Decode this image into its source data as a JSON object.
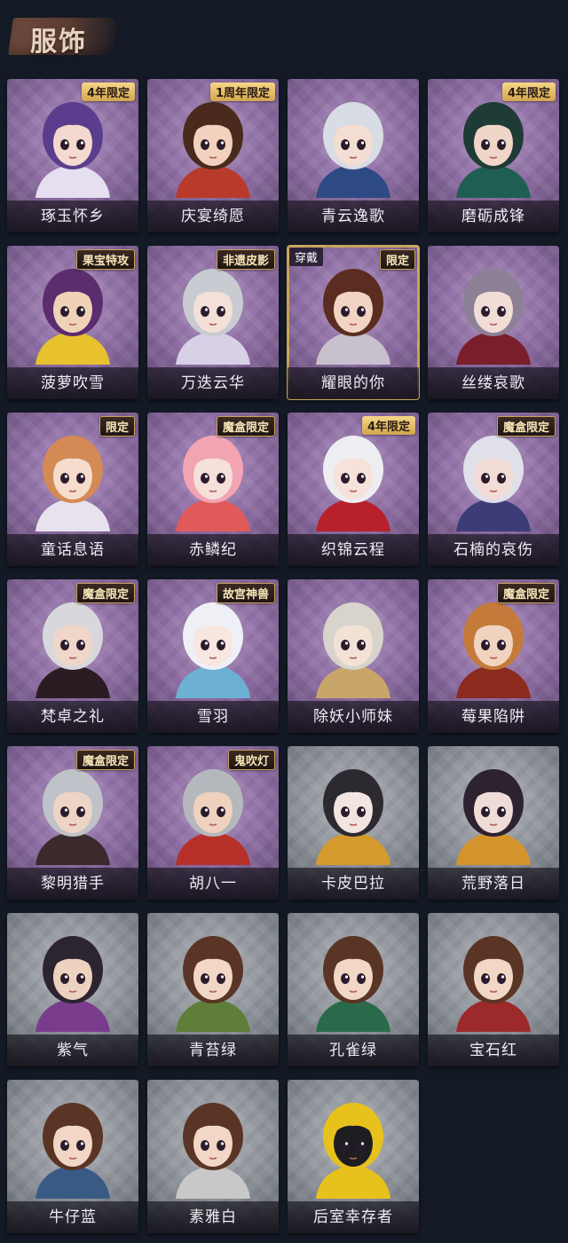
{
  "header": {
    "title": "服饰"
  },
  "items": [
    {
      "label": "琢玉怀乡",
      "tag": "4年限定",
      "theme": "purple",
      "hair": "#5a3d8c",
      "skin": "#f3d9cf",
      "outfit": "#e6dff0"
    },
    {
      "label": "庆宴绮愿",
      "tag": "1周年限定",
      "theme": "purple",
      "hair": "#4a2a1c",
      "skin": "#f2d2bf",
      "outfit": "#b93a2a"
    },
    {
      "label": "青云逸歌",
      "tag": "",
      "theme": "purple",
      "hair": "#d8dce4",
      "skin": "#f4ddd2",
      "outfit": "#2d4a84"
    },
    {
      "label": "磨砺成锋",
      "tag": "4年限定",
      "theme": "purple",
      "hair": "#1f3b36",
      "skin": "#f0d6c8",
      "outfit": "#1f5f52"
    },
    {
      "label": "菠萝吹雪",
      "tag": "果宝特攻",
      "theme": "purple",
      "hair": "#5b2c6e",
      "skin": "#f0d2b8",
      "outfit": "#e8c22e"
    },
    {
      "label": "万迭云华",
      "tag": "非遗皮影",
      "theme": "purple",
      "hair": "#c8ccd2",
      "skin": "#f4e0d8",
      "outfit": "#d7d0e6"
    },
    {
      "label": "耀眼的你",
      "tag": "限定",
      "worn": "穿戴",
      "theme": "purple",
      "hair": "#5b2c20",
      "skin": "#f2d4c4",
      "outfit": "#c8c0cc",
      "selected": true
    },
    {
      "label": "丝缕哀歌",
      "tag": "",
      "theme": "purple",
      "hair": "#8c8196",
      "skin": "#f2dcd6",
      "outfit": "#7a1e2c"
    },
    {
      "label": "童话息语",
      "tag": "限定",
      "theme": "purple",
      "hair": "#d48a54",
      "skin": "#f6dccc",
      "outfit": "#e8e2ee"
    },
    {
      "label": "赤鳞纪",
      "tag": "魔盒限定",
      "theme": "purple",
      "hair": "#f2a4b2",
      "skin": "#f6e0da",
      "outfit": "#e05a5a"
    },
    {
      "label": "织锦云程",
      "tag": "4年限定",
      "theme": "purple",
      "hair": "#eeeef2",
      "skin": "#f6e2da",
      "outfit": "#b8202c"
    },
    {
      "label": "石楠的哀伤",
      "tag": "魔盒限定",
      "theme": "purple",
      "hair": "#dfe0ea",
      "skin": "#f2dcd8",
      "outfit": "#3c3c78"
    },
    {
      "label": "梵卓之礼",
      "tag": "魔盒限定",
      "theme": "purple",
      "hair": "#d8d8dc",
      "skin": "#f0d6c8",
      "outfit": "#2a1c22"
    },
    {
      "label": "雪羽",
      "tag": "故宫神兽",
      "theme": "purple",
      "hair": "#eef0f6",
      "skin": "#f8e6e0",
      "outfit": "#6cb0d4"
    },
    {
      "label": "除妖小师妹",
      "tag": "",
      "theme": "purple",
      "hair": "#d8d4cc",
      "skin": "#f2e2d6",
      "outfit": "#c8a66a"
    },
    {
      "label": "莓果陷阱",
      "tag": "魔盒限定",
      "theme": "purple",
      "hair": "#c47a3a",
      "skin": "#f0d4c0",
      "outfit": "#8c2a1e"
    },
    {
      "label": "黎明猎手",
      "tag": "魔盒限定",
      "theme": "purple",
      "hair": "#bfc2c8",
      "skin": "#eed4c4",
      "outfit": "#3a2a2c"
    },
    {
      "label": "胡八一",
      "tag": "鬼吹灯",
      "theme": "purple",
      "hair": "#b4b8bc",
      "skin": "#eed2be",
      "outfit": "#b8302a"
    },
    {
      "label": "卡皮巴拉",
      "tag": "",
      "theme": "gray",
      "hair": "#2c2a30",
      "skin": "#f2e4e0",
      "outfit": "#d49a2e"
    },
    {
      "label": "荒野落日",
      "tag": "",
      "theme": "gray",
      "hair": "#2c2230",
      "skin": "#f0dcd6",
      "outfit": "#d4942c"
    },
    {
      "label": "紫气",
      "tag": "",
      "theme": "gray",
      "hair": "#2c2430",
      "skin": "#eed2c0",
      "outfit": "#7a3c8c"
    },
    {
      "label": "青苔绿",
      "tag": "",
      "theme": "gray",
      "hair": "#5a3424",
      "skin": "#f2d6c6",
      "outfit": "#5e7e3a"
    },
    {
      "label": "孔雀绿",
      "tag": "",
      "theme": "gray",
      "hair": "#5a3424",
      "skin": "#f2d6c6",
      "outfit": "#2a6a4a"
    },
    {
      "label": "宝石红",
      "tag": "",
      "theme": "gray",
      "hair": "#5a3424",
      "skin": "#f2d6c6",
      "outfit": "#9c2a2a"
    },
    {
      "label": "牛仔蓝",
      "tag": "",
      "theme": "gray",
      "hair": "#5a3424",
      "skin": "#f2d6c6",
      "outfit": "#3a5a86"
    },
    {
      "label": "素雅白",
      "tag": "",
      "theme": "gray",
      "hair": "#5a3424",
      "skin": "#f2d6c6",
      "outfit": "#c8c8c8"
    },
    {
      "label": "后室幸存者",
      "tag": "",
      "theme": "gray",
      "hair": "#e8c21c",
      "skin": "#1e1e22",
      "outfit": "#e8c21c"
    }
  ]
}
